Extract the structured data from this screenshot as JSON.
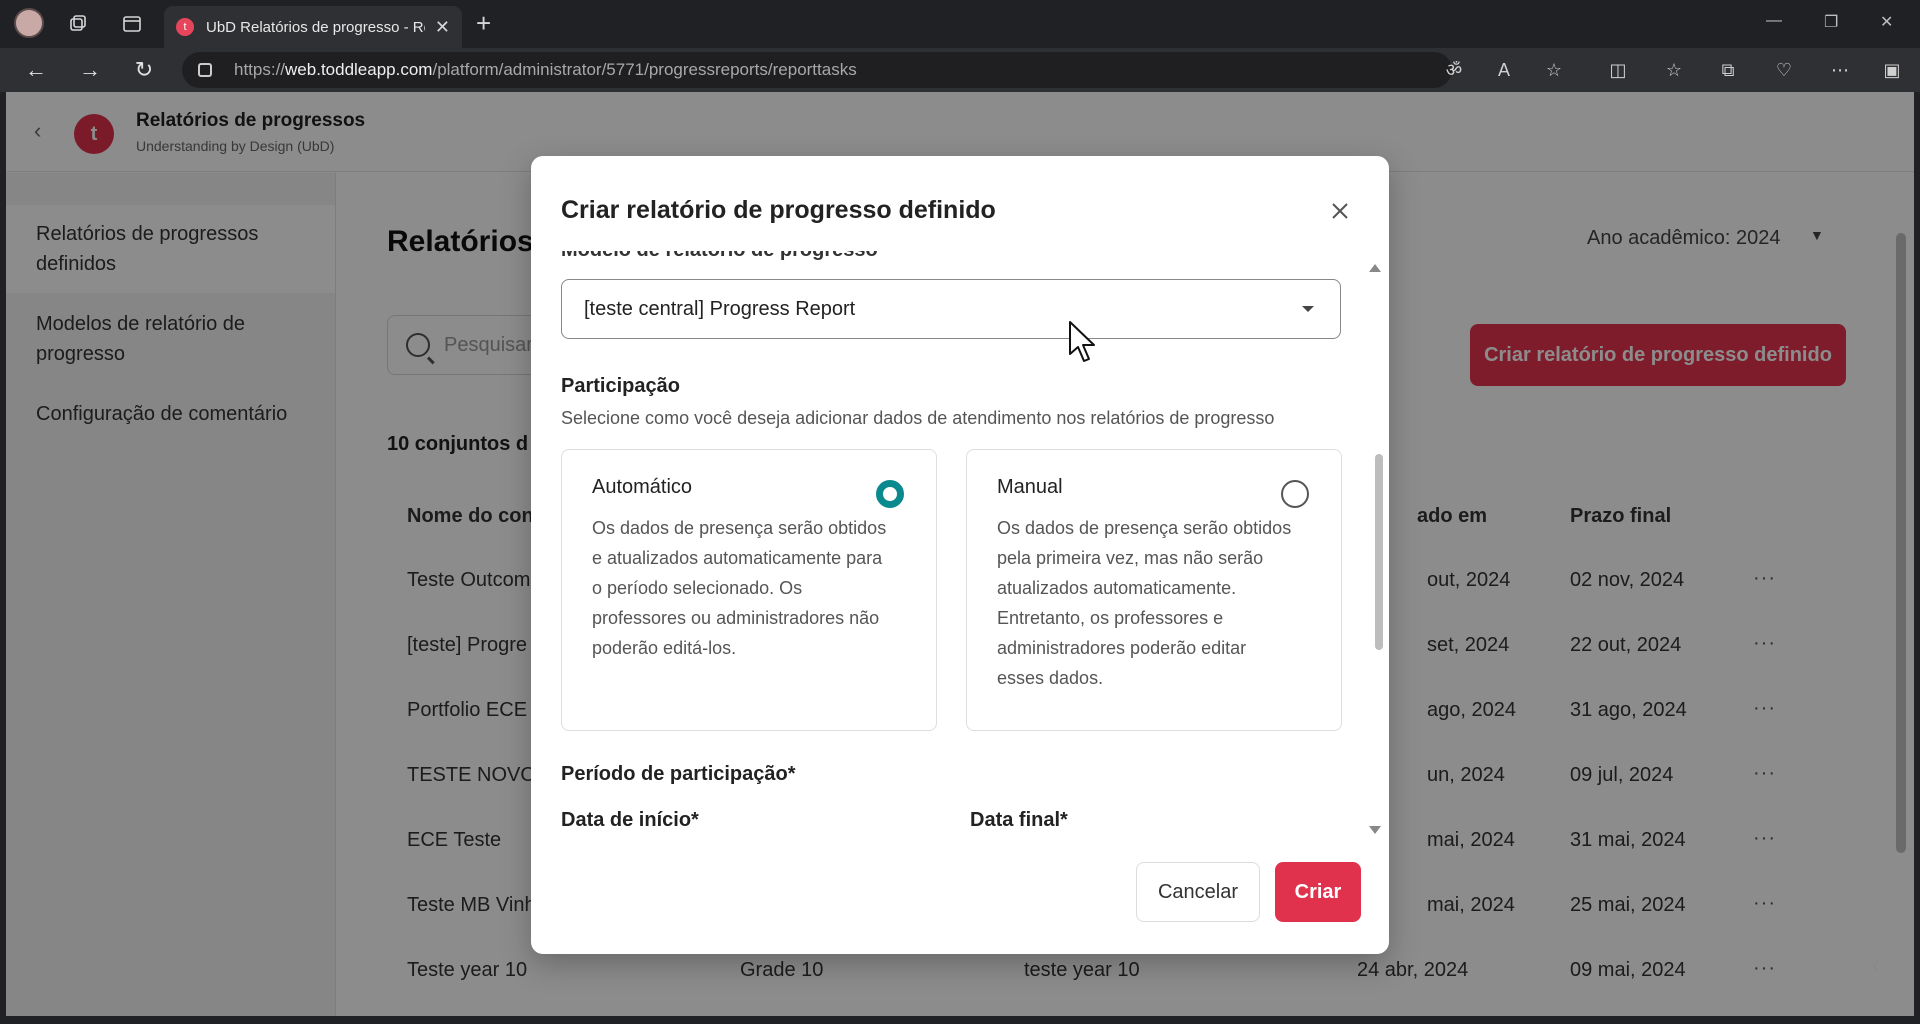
{
  "browser": {
    "tab_title": "UbD Relatórios de progresso - Re",
    "tab_favicon": "t",
    "url_prefix": "https://",
    "url_domain": "web.toddleapp.com",
    "url_path": "/platform/administrator/5771/progressreports/reporttasks"
  },
  "header": {
    "logo_letter": "t",
    "title": "Relatórios de progressos",
    "subtitle": "Understanding by Design (UbD)"
  },
  "sidebar": {
    "items": [
      {
        "label": "Relatórios de progressos definidos"
      },
      {
        "label": "Modelos de relatório de progresso"
      },
      {
        "label": "Configuração de comentário"
      }
    ]
  },
  "main": {
    "title": "Relatórios",
    "year_label": "Ano acadêmico:  2024",
    "search_placeholder": "Pesquisar",
    "create_button": "Criar relatório de progresso definido",
    "count_text": "10 conjuntos d",
    "columns": [
      "Nome do con",
      "ado em",
      "Prazo final"
    ],
    "rows": [
      {
        "name": "Teste Outcom",
        "grade": "",
        "template": "",
        "created": "out, 2024",
        "due": "02 nov, 2024"
      },
      {
        "name": "[teste] Progre",
        "grade": "",
        "template": "",
        "created": "set, 2024",
        "due": "22 out, 2024"
      },
      {
        "name": "Portfolio ECE",
        "grade": "",
        "template": "",
        "created": "ago, 2024",
        "due": "31 ago, 2024"
      },
      {
        "name": "TESTE NOVO",
        "grade": "",
        "template": "",
        "created": "un, 2024",
        "due": "09 jul, 2024"
      },
      {
        "name": "ECE Teste",
        "grade": "",
        "template": "",
        "created": "mai, 2024",
        "due": "31 mai, 2024"
      },
      {
        "name": "Teste MB Vinh",
        "grade": "",
        "template": "",
        "created": "mai, 2024",
        "due": "25 mai, 2024"
      },
      {
        "name": "Teste year 10",
        "grade": "Grade 10",
        "template": "teste year 10",
        "created": "24 abr, 2024",
        "due": "09 mai, 2024"
      }
    ]
  },
  "modal": {
    "title": "Criar relatório de progresso definido",
    "partial_label": "Modelo de relatório de progresso",
    "template_select_value": "[teste central] Progress Report",
    "participation_title": "Participação",
    "participation_desc": "Selecione como você deseja adicionar dados de atendimento nos relatórios de progresso",
    "options": [
      {
        "title": "Automático",
        "desc": "Os dados de presença serão obtidos e atualizados automaticamente para o período selecionado. Os professores ou administradores não poderão editá-los.",
        "selected": true
      },
      {
        "title": "Manual",
        "desc": "Os dados de presença serão obtidos pela primeira vez, mas não serão atualizados automaticamente. Entretanto, os professores e administradores poderão editar esses dados.",
        "selected": false
      }
    ],
    "period_title": "Período de participação*",
    "start_label": "Data de início*",
    "end_label": "Data final*",
    "cancel_label": "Cancelar",
    "create_label": "Criar"
  },
  "colors": {
    "accent": "#e0324d",
    "radio_selected": "#0a8a8f"
  }
}
